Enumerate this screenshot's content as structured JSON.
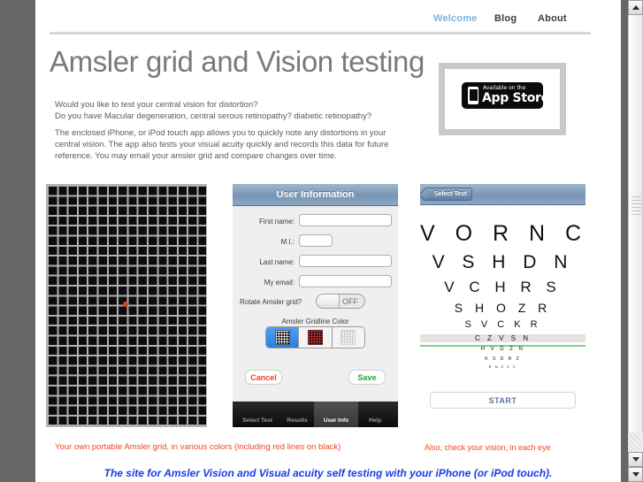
{
  "nav": {
    "items": [
      {
        "label": "Welcome",
        "active": true
      },
      {
        "label": "Blog",
        "active": false
      },
      {
        "label": "About",
        "active": false
      }
    ]
  },
  "header": {
    "title": "Amsler grid and Vision testing"
  },
  "intro": {
    "paragraph1": "Would you like to test your central vision for distortion?\nDo you have Macular degeneration, central serous retinopathy? diabetic retinopathy?",
    "paragraph2": "The enclosed iPhone, or iPod touch app allows you to quickly note any distortions in your central vision. The app also tests your visual acuity quickly and records this data for future reference. You may email your amsler grid and compare changes over time."
  },
  "app_store_badge": {
    "small_text": "Available on the",
    "large_text": "App Store",
    "icon": "iphone-icon"
  },
  "amsler_grid": {
    "background_color": "#0c0c0c",
    "line_color": "#b0b0b0",
    "center_dot_color": "#e03a20"
  },
  "user_form": {
    "title": "User Information",
    "fields": [
      {
        "label": "First name:",
        "value": "",
        "placeholder": ""
      },
      {
        "label": "M.I.:",
        "value": "",
        "placeholder": ""
      },
      {
        "label": "Last name:",
        "value": "",
        "placeholder": ""
      },
      {
        "label": "My email:",
        "value": "",
        "placeholder": ""
      }
    ],
    "rotate_label": "Rotate Amsler grid?",
    "rotate_state": "OFF",
    "gridline_color_label": "Amsler Gridline Color",
    "gridline_swatches": [
      {
        "name": "white-on-black",
        "selected": true
      },
      {
        "name": "red-on-black",
        "selected": false
      },
      {
        "name": "gray-on-white",
        "selected": false
      }
    ],
    "cancel_label": "Cancel",
    "save_label": "Save",
    "cancel_color": "#e8402a",
    "save_color": "#27a13a",
    "tabs": [
      {
        "label": "Select Test",
        "active": false
      },
      {
        "label": "Results",
        "active": false
      },
      {
        "label": "User Info",
        "active": true
      },
      {
        "label": "Help",
        "active": false
      }
    ]
  },
  "eye_chart": {
    "back_button": "Select Test",
    "rows": [
      "V O R N C",
      "V S H D N",
      "V C H R S",
      "S H O Z R",
      "S V C K R",
      "C Z V S N",
      "H V D Z N",
      "K S D R Z",
      "R N Z V C"
    ],
    "acuity_line_color": "#7fd07f",
    "start_label": "START",
    "start_color": "#5c73a0"
  },
  "captions": {
    "left": "Your own portable Amsler grid, in various colors (including red lines on black)",
    "right": "Also, check your vision, in each eye",
    "bottom": "The site for Amsler Vision and Visual acuity self testing with your iPhone (or iPod touch).",
    "left_color": "#f4451a",
    "bottom_color": "#1a3ce8"
  },
  "scrollbar": {
    "up_icon": "triangle-up-icon",
    "down_icon": "triangle-down-icon"
  }
}
